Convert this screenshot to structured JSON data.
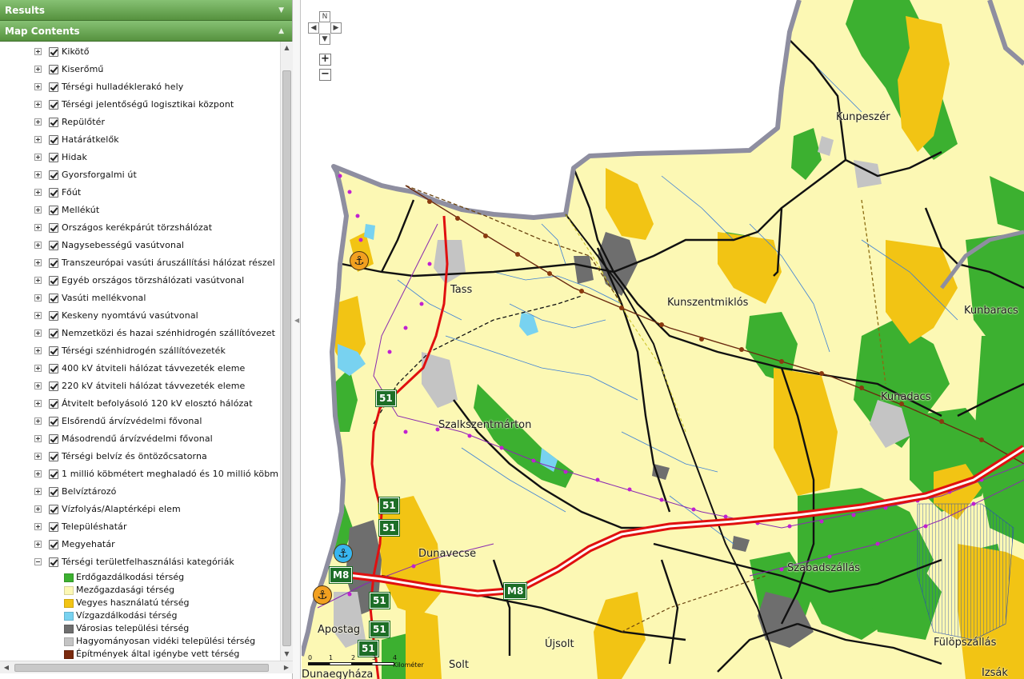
{
  "panel": {
    "results_title": "Results",
    "contents_title": "Map Contents",
    "layers": [
      {
        "label": "Kikötő",
        "expanded": false
      },
      {
        "label": "Kiserőmű",
        "expanded": false
      },
      {
        "label": "Térségi hulladéklerakó hely",
        "expanded": false
      },
      {
        "label": "Térségi jelentőségű logisztikai központ",
        "expanded": false
      },
      {
        "label": "Repülőtér",
        "expanded": false
      },
      {
        "label": "Határátkelők",
        "expanded": false
      },
      {
        "label": "Hidak",
        "expanded": false
      },
      {
        "label": "Gyorsforgalmi út",
        "expanded": false
      },
      {
        "label": "Főút",
        "expanded": false
      },
      {
        "label": "Mellékút",
        "expanded": false
      },
      {
        "label": "Országos kerékpárút törzshálózat",
        "expanded": false
      },
      {
        "label": "Nagysebességű vasútvonal",
        "expanded": false
      },
      {
        "label": "Transzeurópai vasúti áruszállítási hálózat részel",
        "expanded": false
      },
      {
        "label": "Egyéb országos törzshálózati vasútvonal",
        "expanded": false
      },
      {
        "label": "Vasúti mellékvonal",
        "expanded": false
      },
      {
        "label": "Keskeny nyomtávú vasútvonal",
        "expanded": false
      },
      {
        "label": "Nemzetközi és hazai szénhidrogén szállítóvezet",
        "expanded": false
      },
      {
        "label": "Térségi szénhidrogén szállítóvezeték",
        "expanded": false
      },
      {
        "label": "400 kV átviteli hálózat távvezeték eleme",
        "expanded": false
      },
      {
        "label": "220 kV átviteli hálózat távvezeték eleme",
        "expanded": false
      },
      {
        "label": "Átvitelt befolyásoló 120 kV elosztó hálózat",
        "expanded": false
      },
      {
        "label": "Elsőrendű árvízvédelmi fővonal",
        "expanded": false
      },
      {
        "label": "Másodrendű árvízvédelmi fővonal",
        "expanded": false
      },
      {
        "label": "Térségi belvíz és öntözőcsatorna",
        "expanded": false
      },
      {
        "label": "1 millió köbmétert meghaladó és 10 millió köbm",
        "expanded": false
      },
      {
        "label": "Belvíztározó",
        "expanded": false
      },
      {
        "label": "Vízfolyás/Alaptérképi elem",
        "expanded": false
      },
      {
        "label": "Településhatár",
        "expanded": false
      },
      {
        "label": "Megyehatár",
        "expanded": false
      },
      {
        "label": "Térségi területfelhasználási kategóriák",
        "expanded": true
      }
    ],
    "legend": [
      {
        "label": "Erdőgazdálkodási térség",
        "color": "#3cb030"
      },
      {
        "label": "Mezőgazdasági térség",
        "color": "#fcf8b4"
      },
      {
        "label": "Vegyes használatú térség",
        "color": "#f2c414"
      },
      {
        "label": "Vízgazdálkodási térség",
        "color": "#78d2f0"
      },
      {
        "label": "Városias települési térség",
        "color": "#6e6e6e"
      },
      {
        "label": "Hagyományosan vidéki települési térség",
        "color": "#c4c4c4"
      },
      {
        "label": "Építmények által igénybe vett térség",
        "color": "#7a2a0e"
      }
    ]
  },
  "map": {
    "places": [
      {
        "name": "Kunpeszér"
      },
      {
        "name": "Tass"
      },
      {
        "name": "Kunszentmiklós"
      },
      {
        "name": "Kunbaracs"
      },
      {
        "name": "Kunadacs"
      },
      {
        "name": "Szalkszentmárton"
      },
      {
        "name": "Dunavecse"
      },
      {
        "name": "Szabadszállás"
      },
      {
        "name": "Apostag"
      },
      {
        "name": "Újsolt"
      },
      {
        "name": "Solt"
      },
      {
        "name": "Fülöpszállás"
      },
      {
        "name": "Dunaegyháza"
      },
      {
        "name": "Izsák"
      }
    ],
    "shields": [
      "51",
      "51",
      "51",
      "M8",
      "51",
      "51",
      "51",
      "M8"
    ],
    "scale": {
      "ticks": [
        "0",
        "1",
        "2",
        "3",
        "4"
      ],
      "unit": "Kilométer"
    },
    "nav": {
      "north": "N",
      "zoom_in": "+",
      "zoom_out": "−"
    }
  }
}
